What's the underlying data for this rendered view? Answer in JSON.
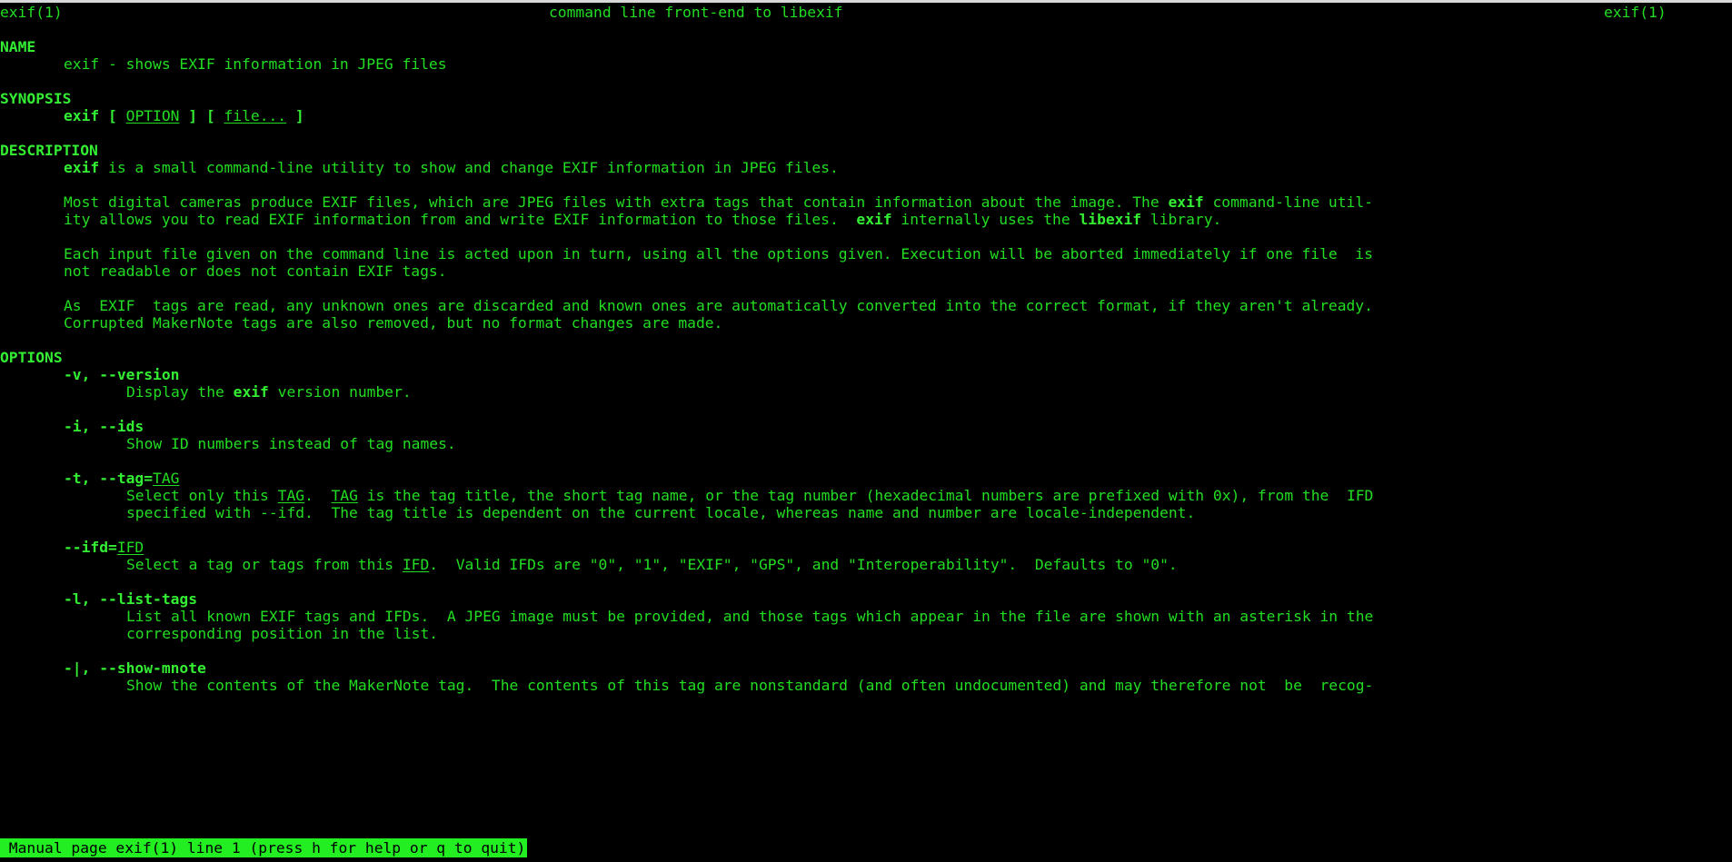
{
  "header": {
    "left": "exif(1)",
    "center": "command line front-end to libexif",
    "right": "exif(1)"
  },
  "sections": {
    "name": {
      "heading": "NAME",
      "text": "exif - shows EXIF information in JPEG files"
    },
    "synopsis": {
      "heading": "SYNOPSIS",
      "cmd": "exif",
      "open1": " [ ",
      "arg1": "OPTION",
      "close1": " ] [ ",
      "arg2": "file...",
      "close2": " ]"
    },
    "description": {
      "heading": "DESCRIPTION",
      "p1_bold": "exif",
      "p1_rest": " is a small command-line utility to show and change EXIF information in JPEG files.",
      "p2_l1_a": "Most digital cameras produce EXIF files, which are JPEG files with extra tags that contain information about the image. The ",
      "p2_l1_b": "exif",
      "p2_l1_c": " command-line util-",
      "p2_l2_a": "ity allows you to read EXIF information from and write EXIF information to those files.  ",
      "p2_l2_b": "exif",
      "p2_l2_c": " internally uses the ",
      "p2_l2_d": "libexif",
      "p2_l2_e": " library.",
      "p3_l1": "Each input file given on the command line is acted upon in turn, using all the options given. Execution will be aborted immediately if one file  is",
      "p3_l2": "not readable or does not contain EXIF tags.",
      "p4_l1": "As  EXIF  tags are read, any unknown ones are discarded and known ones are automatically converted into the correct format, if they aren't already.",
      "p4_l2": "Corrupted MakerNote tags are also removed, but no format changes are made."
    },
    "options": {
      "heading": "OPTIONS",
      "items": [
        {
          "flag": "-v, --version",
          "desc_a": "Display the ",
          "desc_b": "exif",
          "desc_c": " version number."
        },
        {
          "flag": "-i, --ids",
          "desc": "Show ID numbers instead of tag names."
        },
        {
          "flag": "-t, --tag=",
          "flag_arg": "TAG",
          "l1_a": "Select only this ",
          "l1_b": "TAG",
          "l1_c": ".  ",
          "l1_d": "TAG",
          "l1_e": " is the tag title, the short tag name, or the tag number (hexadecimal numbers are prefixed with 0x), from the  IFD",
          "l2": "specified with --ifd.  The tag title is dependent on the current locale, whereas name and number are locale-independent."
        },
        {
          "flag": "--ifd=",
          "flag_arg": "IFD",
          "l1_a": "Select a tag or tags from this ",
          "l1_b": "IFD",
          "l1_c": ".  Valid IFDs are \"0\", \"1\", \"EXIF\", \"GPS\", and \"Interoperability\".  Defaults to \"0\"."
        },
        {
          "flag": "-l, --list-tags",
          "l1": "List all known EXIF tags and IFDs.  A JPEG image must be provided, and those tags which appear in the file are shown with an asterisk in the",
          "l2": "corresponding position in the list."
        },
        {
          "flag": "-|, --show-mnote",
          "l1": "Show the contents of the MakerNote tag.  The contents of this tag are nonstandard (and often undocumented) and may therefore not  be  recog-"
        }
      ]
    }
  },
  "status_bar": {
    "text": " Manual page exif(1) line 1 (press h for help or q to quit)"
  },
  "colors": {
    "text": "#22dd22",
    "bold": "#33ee33",
    "background": "#000000",
    "status_bg": "#22ee22",
    "status_fg": "#000000"
  }
}
